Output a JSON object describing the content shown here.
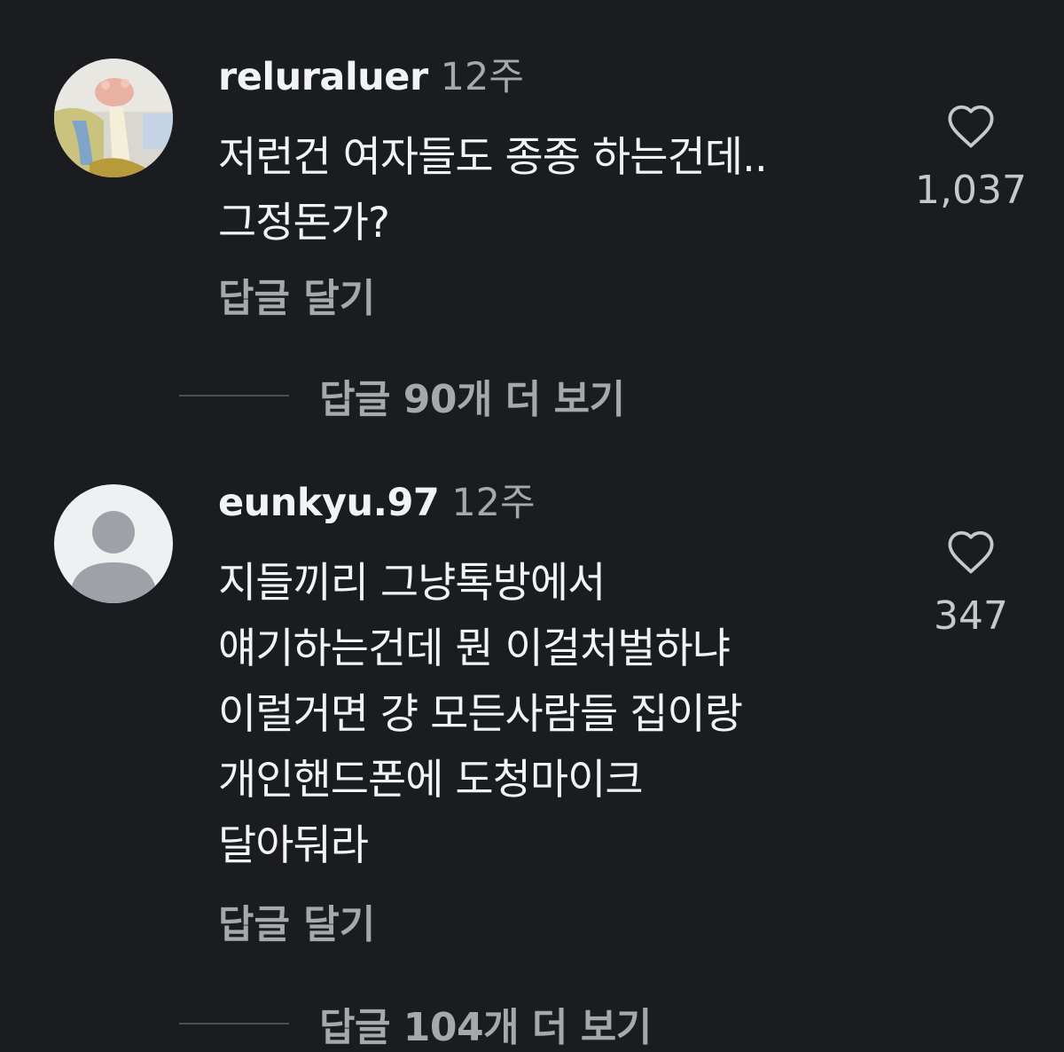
{
  "comments": [
    {
      "username": "reluraluer",
      "time": "12주",
      "body_lines": [
        "저런건 여자들도 종종 하는건데..",
        "그정돈가?"
      ],
      "like_count": "1,037",
      "reply_label": "답글 달기",
      "view_replies_label": "답글 90개 더 보기",
      "avatar_icon": "photo-avatar-icon"
    },
    {
      "username": "eunkyu.97",
      "time": "12주",
      "body_lines": [
        "지들끼리 그냥톡방에서",
        "얘기하는건데 뭔 이걸처벌하냐",
        "이럴거면 걍 모든사람들 집이랑",
        "개인핸드폰에 도청마이크",
        "달아둬라"
      ],
      "like_count": "347",
      "reply_label": "답글 달기",
      "view_replies_label": "답글 104개 더 보기",
      "avatar_icon": "default-avatar-icon"
    }
  ],
  "colors": {
    "background": "#1a1c1f",
    "primary_text": "#f2f3f5",
    "secondary_text": "#a5a8ad",
    "divider": "#4a4d52"
  },
  "icons": {
    "like": "heart-outline-icon"
  }
}
